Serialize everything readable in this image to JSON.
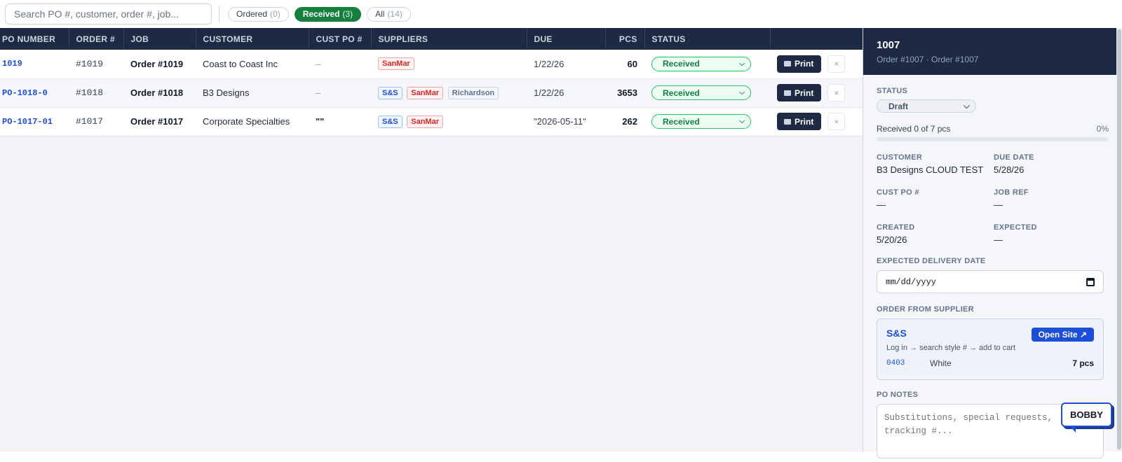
{
  "search": {
    "placeholder": "Search PO #, customer, order #, job..."
  },
  "filters": [
    {
      "label": "Ordered",
      "count": "(0)"
    },
    {
      "label": "Received",
      "count": "(3)"
    },
    {
      "label": "All",
      "count": "(14)"
    }
  ],
  "table": {
    "headers": [
      "PO NUMBER",
      "ORDER #",
      "JOB",
      "CUSTOMER",
      "CUST PO #",
      "SUPPLIERS",
      "DUE",
      "PCS",
      "STATUS",
      ""
    ],
    "rows": [
      {
        "po": "1019",
        "order": "#1019",
        "job": "Order #1019",
        "customer": "Coast to Coast Inc",
        "cust_po": "–",
        "suppliers": [
          "SanMar"
        ],
        "due": "1/22/26",
        "pcs": "60",
        "status": "Received",
        "print": "Print",
        "close": "×"
      },
      {
        "po": "PO-1018-0",
        "order": "#1018",
        "job": "Order #1018",
        "customer": "B3 Designs",
        "cust_po": "–",
        "suppliers": [
          "S&S",
          "SanMar",
          "Richardson"
        ],
        "due": "1/22/26",
        "pcs": "3653",
        "status": "Received",
        "print": "Print",
        "close": "×"
      },
      {
        "po": "PO-1017-01",
        "order": "#1017",
        "job": "Order #1017",
        "customer": "Corporate Specialties",
        "cust_po": "\"\"",
        "suppliers": [
          "S&S",
          "SanMar"
        ],
        "due": "\"2026-05-11\"",
        "pcs": "262",
        "status": "Received",
        "print": "Print",
        "close": "×"
      }
    ]
  },
  "panel": {
    "title": "1007",
    "subtitle": "Order #1007 · Order #1007",
    "status_label": "STATUS",
    "status_value": "Draft",
    "received_text": "Received 0 of 7 pcs",
    "received_pct": "0%",
    "received_fraction": 0,
    "fields": {
      "customer_label": "CUSTOMER",
      "customer": "B3 Designs CLOUD TEST",
      "due_label": "DUE DATE",
      "due": "5/28/26",
      "custpo_label": "CUST PO #",
      "custpo": "—",
      "jobref_label": "JOB REF",
      "jobref": "—",
      "created_label": "CREATED",
      "created": "5/20/26",
      "expected_label": "EXPECTED",
      "expected": "—"
    },
    "delivery_label": "EXPECTED DELIVERY DATE",
    "delivery_placeholder": "mm/dd/yyyy",
    "supplier_section_label": "ORDER FROM SUPPLIER",
    "supplier": {
      "name": "S&S",
      "open_label": "Open Site ↗",
      "hint": "Log in → search style # → add to cart",
      "style": "0403",
      "color": "White",
      "qty": "7 pcs"
    },
    "notes_label": "PO NOTES",
    "notes_placeholder": "Substitutions, special requests, tracking #..."
  },
  "chat_button": "BOBBY",
  "colors": {
    "navy": "#1e2a44",
    "green": "#15803d",
    "blue": "#1d4ed8"
  }
}
